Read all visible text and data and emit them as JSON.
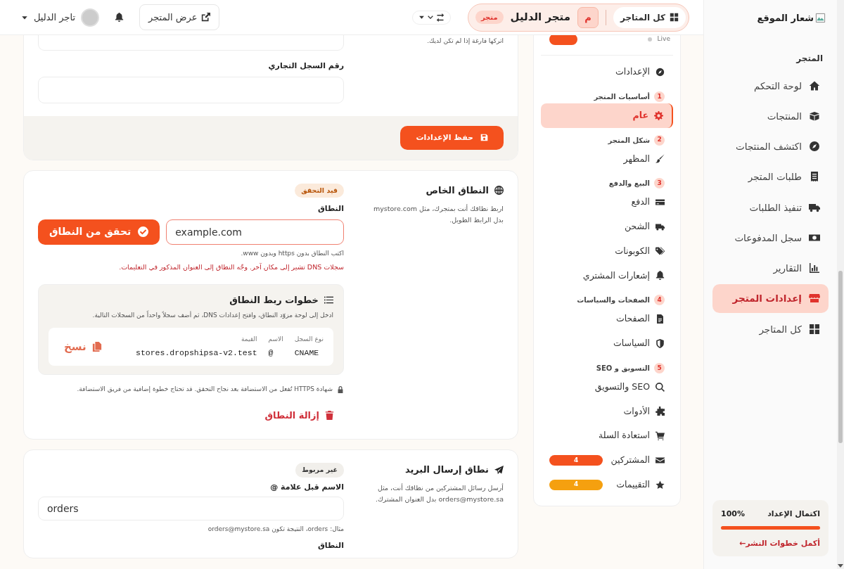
{
  "topbar": {
    "stores_button": "كل المتاجر",
    "store_avatar": "م",
    "store_name": "متجر الدليل",
    "store_badge": "متجر",
    "view_store_button": "عرض المتجر",
    "user_name": "تاجر الدليل"
  },
  "sidebar": {
    "logo_alt": "شعار الموقع",
    "section_title": "المتجر",
    "items": [
      {
        "label": "لوحة التحكم",
        "selected": false
      },
      {
        "label": "المنتجات",
        "selected": false
      },
      {
        "label": "اكتشف المنتجات",
        "selected": false
      },
      {
        "label": "طلبات المتجر",
        "selected": false
      },
      {
        "label": "تنفيذ الطلبات",
        "selected": false
      },
      {
        "label": "سجل المدفوعات",
        "selected": false
      },
      {
        "label": "التقارير",
        "selected": false
      },
      {
        "label": "إعدادات المتجر",
        "selected": true
      },
      {
        "label": "كل المتاجر",
        "selected": false
      }
    ],
    "setup": {
      "title": "اكتمال الإعداد",
      "percent": "100%",
      "level": 1,
      "link": "أكمل خطوات النشر←"
    }
  },
  "settings_nav": {
    "status": "Live",
    "overview": {
      "label": "الإعدادات",
      "selected": false
    },
    "groups": [
      {
        "number": "1",
        "title": "أساسيات المتجر",
        "items": [
          {
            "label": "عام",
            "selected": true
          }
        ]
      },
      {
        "number": "2",
        "title": "شكل المتجر",
        "items": [
          {
            "label": "المظهر",
            "selected": false
          }
        ]
      },
      {
        "number": "3",
        "title": "البيع والدفع",
        "items": [
          {
            "label": "الدفع",
            "selected": false
          },
          {
            "label": "الشحن",
            "selected": false
          },
          {
            "label": "الكوبونات",
            "selected": false
          },
          {
            "label": "إشعارات المشتري",
            "selected": false
          }
        ]
      },
      {
        "number": "4",
        "title": "الصفحات والسياسات",
        "items": [
          {
            "label": "الصفحات",
            "selected": false
          },
          {
            "label": "السياسات",
            "selected": false
          }
        ]
      },
      {
        "number": "5",
        "title": "التسويق و SEO",
        "items": [
          {
            "label": "SEO والتسويق",
            "selected": false
          },
          {
            "label": "الأدوات",
            "selected": false
          },
          {
            "label": "استعادة السلة",
            "selected": false
          },
          {
            "label": "المشتركين",
            "selected": false,
            "badge": "4",
            "color": "#f4511e"
          },
          {
            "label": "التقييمات",
            "selected": false,
            "badge": "4",
            "color": "#f5a00f"
          }
        ]
      }
    ]
  },
  "general_card": {
    "hint": "اتركها فارغة إذا لم تكن لديك.",
    "cr_label": "رقم السجل التجاري",
    "save_button": "حفظ الإعدادات"
  },
  "domain_card": {
    "title": "النطاق الخاص",
    "description": "اربط نطاقك أنت بمتجرك، مثل mystore.com بدل الرابط الطويل.",
    "status": "قيد التحقق",
    "kind": "pending",
    "field_label": "النطاق",
    "value": "example.com",
    "focused": true,
    "verify_button": "تحقق من النطاق",
    "hint": "اكتب النطاق بدون https وبدون www.",
    "error": "سجلات DNS تشير إلى مكان آخر. وجّه النطاق إلى العنوان المذكور في التعليمات.",
    "steps": {
      "title": "خطوات ربط النطاق",
      "description": "ادخل إلى لوحة مزوّد النطاق، وافتح إعدادات DNS، ثم أضف سجلاً واحداً من السجلات التالية.",
      "columns": [
        "نوع السجل",
        "الاسم",
        "القيمة"
      ],
      "record": [
        "CNAME",
        "@",
        "stores.dropshipsa-v2.test"
      ],
      "copy_button": "نسخ"
    },
    "https_note": "شهادة HTTPS تُفعل من الاستضافة بعد نجاح التحقق. قد تحتاج خطوة إضافية من فريق الاستضافة.",
    "remove_button": "إزالة النطاق"
  },
  "email_card": {
    "title": "نطاق إرسال البريد",
    "description": "أرسل رسائل المشتركين من نطاقك أنت، مثل orders@mystore.sa بدل العنوان المشترك.",
    "status": "غير مربوط",
    "kind": "neutral",
    "name_label": "الاسم قبل علامة @",
    "name_value": "orders",
    "name_hint": "مثال: orders، النتيجة تكون orders@mystore.sa",
    "domain_label": "النطاق"
  }
}
